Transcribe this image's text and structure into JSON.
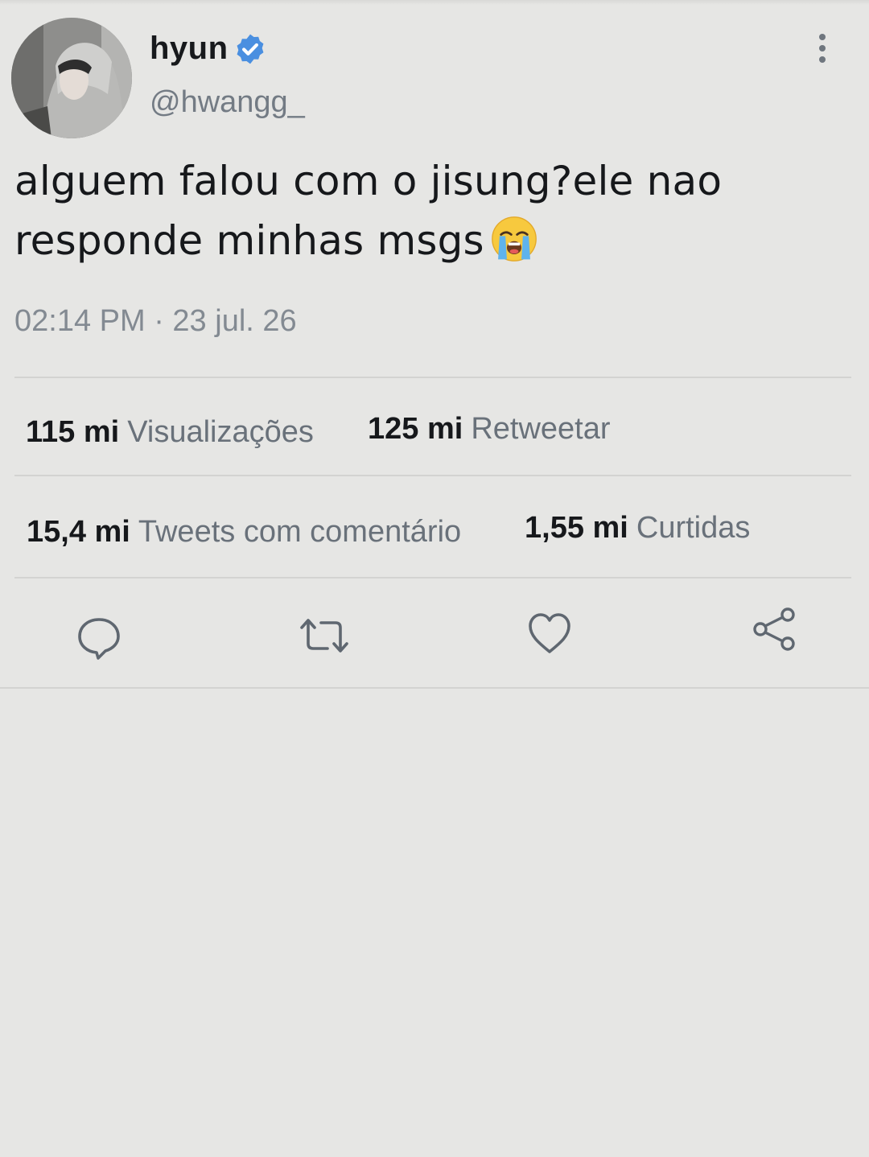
{
  "user": {
    "display_name": "hyun",
    "handle": "@hwangg_",
    "verified": true
  },
  "tweet": {
    "text_line1": "alguem falou com o jisung?ele nao",
    "text_line2": "responde minhas msgs",
    "emoji": "loudly-crying-face",
    "timestamp": "02:14 PM · 23 jul. 26"
  },
  "stats": {
    "views_count": "115 mi",
    "views_label": "Visualizações",
    "retweets_count": "125 mi",
    "retweets_label": "Retweetar",
    "quotes_count": "15,4 mi",
    "quotes_label": "Tweets com comentário",
    "likes_count": "1,55 mi",
    "likes_label": "Curtidas"
  },
  "actions": [
    "reply-icon",
    "retweet-icon",
    "like-icon",
    "share-icon"
  ],
  "colors": {
    "background": "#e6e6e4",
    "verified_badge": "#4a8fe0",
    "muted_text": "#737b84",
    "icon_stroke": "#5f6770"
  }
}
